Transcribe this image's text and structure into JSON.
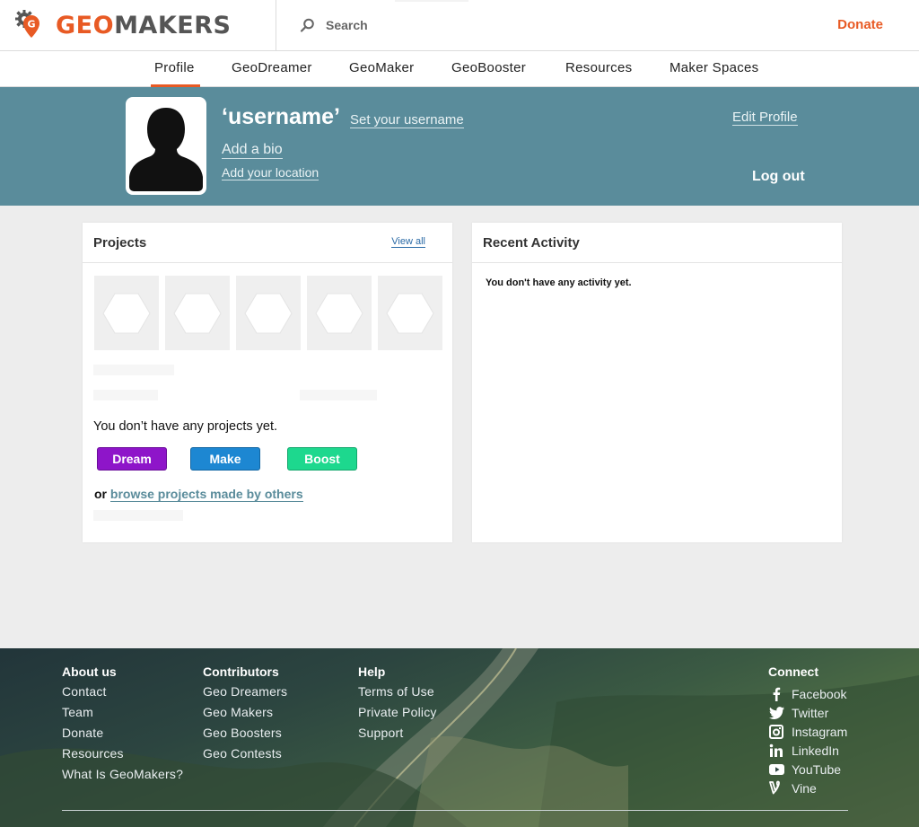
{
  "header": {
    "logo_geo": "GEO",
    "logo_makers": "MAKERS",
    "search_label": "Search",
    "donate_label": "Donate"
  },
  "nav": {
    "items": [
      "Profile",
      "GeoDreamer",
      "GeoMaker",
      "GeoBooster",
      "Resources",
      "Maker Spaces"
    ],
    "active": "Profile"
  },
  "profile": {
    "username": "‘username’",
    "set_username": "Set your username",
    "add_bio": "Add a bio",
    "add_location": "Add your location",
    "edit_profile": "Edit Profile",
    "logout": "Log out"
  },
  "projects": {
    "title": "Projects",
    "view_all": "View all",
    "empty_text": "You don’t have any projects yet.",
    "buttons": {
      "dream": "Dream",
      "make": "Make",
      "boost": "Boost"
    },
    "browse_prefix": "or",
    "browse_link": "browse projects made by others"
  },
  "activity": {
    "title": "Recent Activity",
    "empty_text": "You don't have any activity yet."
  },
  "footer": {
    "about": {
      "heading": "About us",
      "links": [
        "Contact",
        "Team",
        "Donate",
        "Resources",
        "What Is GeoMakers?"
      ]
    },
    "contributors": {
      "heading": "Contributors",
      "links": [
        "Geo Dreamers",
        "Geo Makers",
        "Geo Boosters",
        "Geo Contests"
      ]
    },
    "help": {
      "heading": "Help",
      "links": [
        "Terms of Use",
        "Private Policy",
        "Support"
      ]
    },
    "connect": {
      "heading": "Connect",
      "links": [
        "Facebook",
        "Twitter",
        "Instagram",
        "LinkedIn",
        "YouTube",
        "Vine"
      ]
    }
  },
  "colors": {
    "brand_orange": "#e85a24",
    "banner_teal": "#5a8c9b",
    "dream_purple": "#8e15c9",
    "make_blue": "#1d87d2",
    "boost_green": "#1dd88e"
  }
}
